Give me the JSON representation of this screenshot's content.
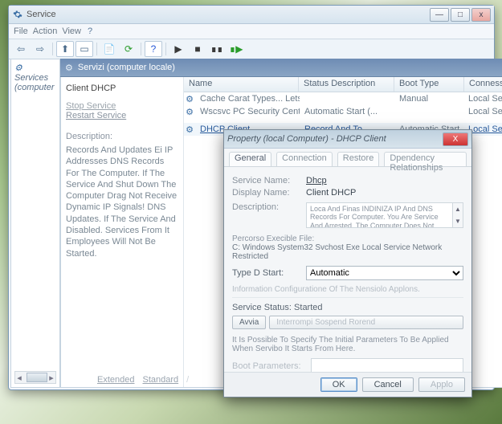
{
  "window": {
    "title": "Service",
    "menu": {
      "file": "File",
      "action": "Action",
      "view": "View",
      "help": "?"
    }
  },
  "tree": {
    "root": "Services (computer"
  },
  "header": {
    "title": "Servizi (computer locale)"
  },
  "detail": {
    "name": "Client DHCP",
    "stop": "Stop Service",
    "restart": "Restart Service",
    "desc_hdr": "Description:",
    "desc": "Records And Updates Ei IP Addresses DNS Records For The Computer. If The Service And Shut Down The Computer Drag Not Receive Dynamic IP Signals! DNS Updates. If The Service And Disabled. Services From It Employees Will Not Be Started."
  },
  "columns": {
    "name": "Name",
    "status": "Status Description",
    "boot": "Boot Type",
    "conn": "Connessie"
  },
  "rows": [
    {
      "name": "Cache Carat Types... Lets...",
      "status": "",
      "boot": "Manual",
      "conn": "Local Service"
    },
    {
      "name": "Wscsvc PC Security Center (C...",
      "status": "Automatic Start (...",
      "boot": "",
      "conn": "Local Service"
    },
    {
      "name": "DHCP Client",
      "status": "Record And To...",
      "boot": "Automatic Start",
      "conn": "Local Service"
    }
  ],
  "tabs": {
    "ext": "Extended",
    "std": "Standard"
  },
  "dialog": {
    "title": "Property (local Computer) - DHCP Client",
    "tabs": {
      "general": "General",
      "conn": "Connection",
      "restore": "Restore",
      "dep": "Dpendency Relationships"
    },
    "svc_name_lbl": "Service Name:",
    "svc_name": "Dhcp",
    "disp_lbl": "Display Name:",
    "disp": "Client DHCP",
    "desc_lbl": "Description:",
    "desc": "Loca And Finas INDINIZA IP And DNS Records For Computer. You Are Service And Arrested. The Computer Does Not",
    "exe_hdr": "Percorso Execible File:",
    "exe": "C: Windows System32 Svchost Exe Local Service Network Restricted",
    "start_lbl": "Type D Start:",
    "start_val": "Automatic",
    "info": "Information Configuratione Of The Nensiolo Applons.",
    "status_lbl": "Service Status:",
    "status_val": "Started",
    "btns": {
      "avvia": "Avvia",
      "long": "Interrompi Sospend Rorend"
    },
    "hint": "It Is Possible To Specify The Initial Parameters To Be Applied When Servibo It Starts From Here.",
    "boot_lbl": "Boot Parameters:",
    "ok": "OK",
    "cancel": "Cancel",
    "apply": "Applo"
  }
}
